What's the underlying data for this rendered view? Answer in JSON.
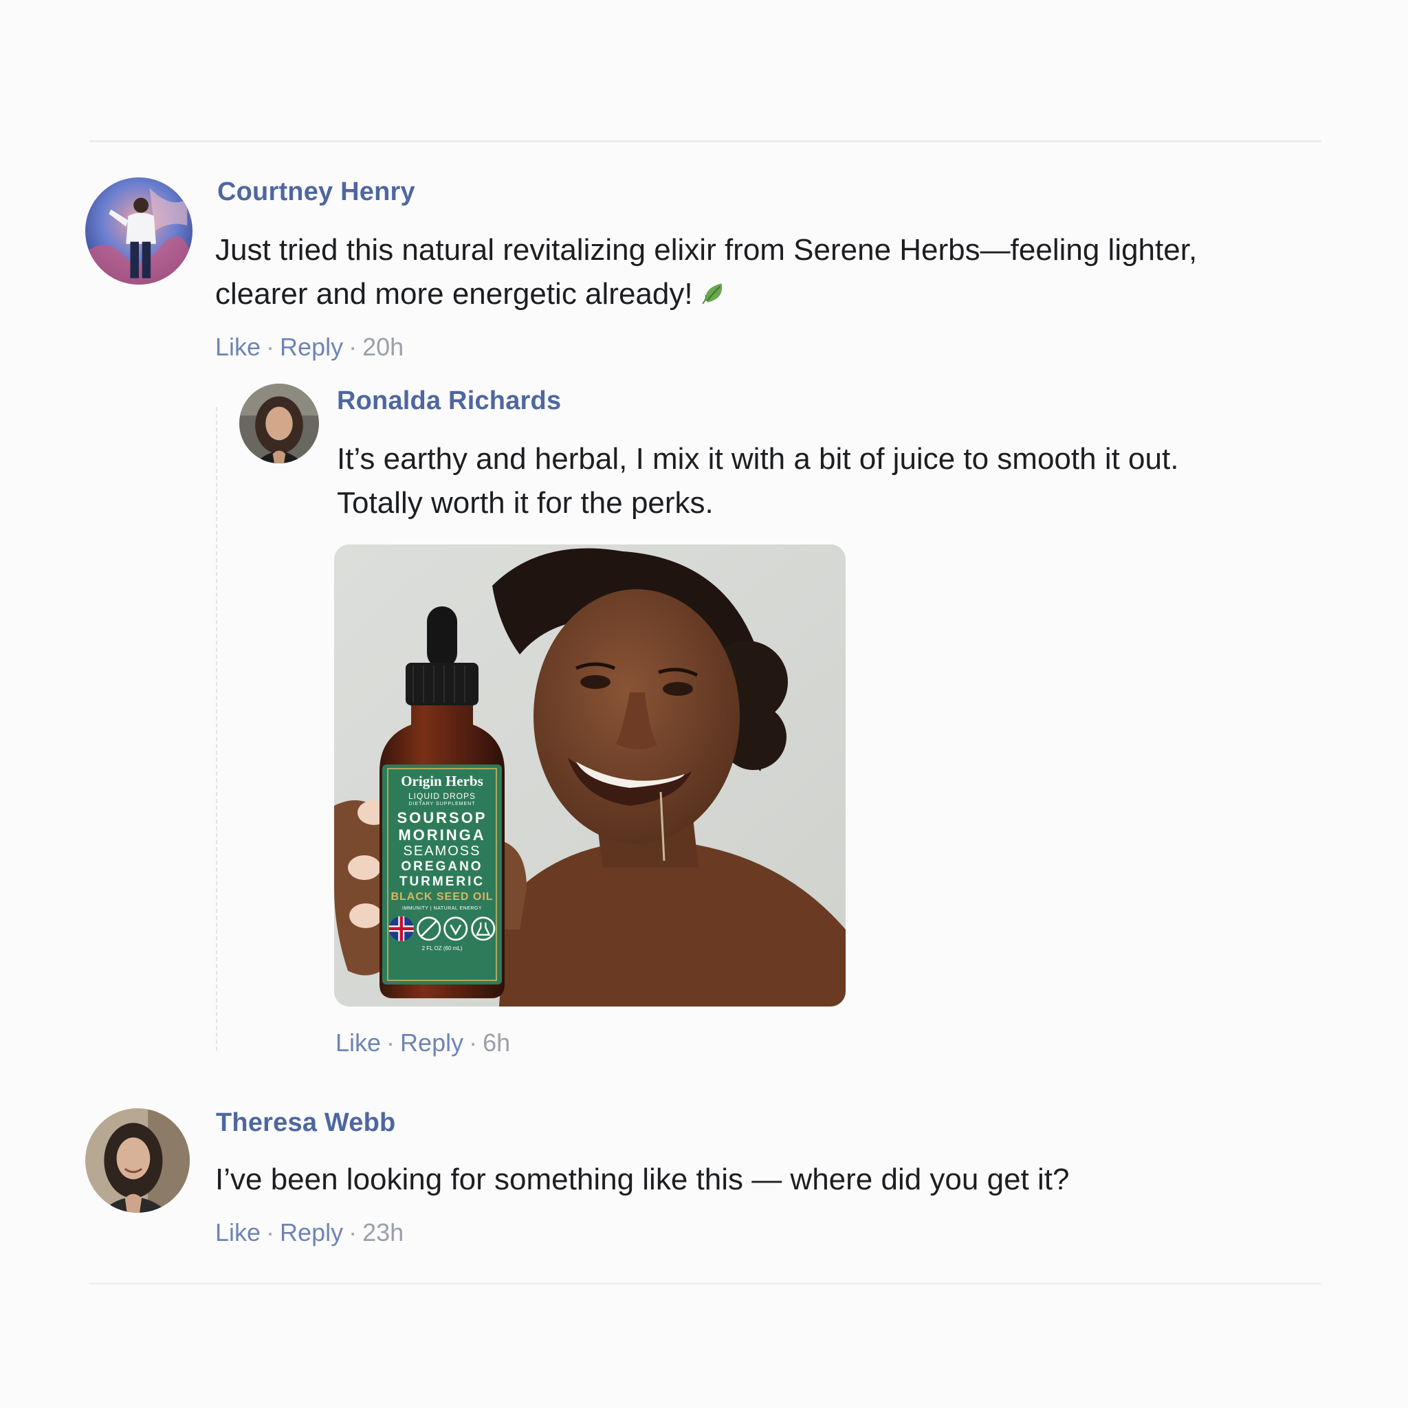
{
  "comments": [
    {
      "author": "Courtney Henry",
      "text_line1": "Just tried this natural revitalizing elixir from Serene Herbs—feeling lighter,",
      "text_line2": "clearer and more energetic already!",
      "like": "Like",
      "reply": "Reply",
      "time": "20h",
      "emoji": "leaf-icon"
    },
    {
      "author": "Ronalda Richards",
      "text_line1": "It’s earthy and herbal, I mix it with a bit of juice to smooth it out.",
      "text_line2": "Totally worth it for the perks.",
      "like": "Like",
      "reply": "Reply",
      "time": "6h"
    },
    {
      "author": "Theresa Webb",
      "text_line1": "I’ve been looking for something like this — where did you get it?",
      "like": "Like",
      "reply": "Reply",
      "time": "23h"
    }
  ],
  "product": {
    "brand": "Origin Herbs",
    "subtitle": "LIQUID DROPS",
    "type": "DIETARY SUPPLEMENT",
    "ingredients": [
      "SOURSOP",
      "MORINGA",
      "SEAMOSS",
      "OREGANO",
      "TURMERIC"
    ],
    "highlight": "BLACK SEED OIL",
    "benefits": "IMMUNITY | NATURAL ENERGY",
    "volume": "2 FL OZ (60 mL)"
  },
  "colors": {
    "author_blue": "#4f67a0",
    "link_blue": "#6f84b5",
    "label_green": "#2e7b5a",
    "highlight_gold": "#d8b765"
  }
}
